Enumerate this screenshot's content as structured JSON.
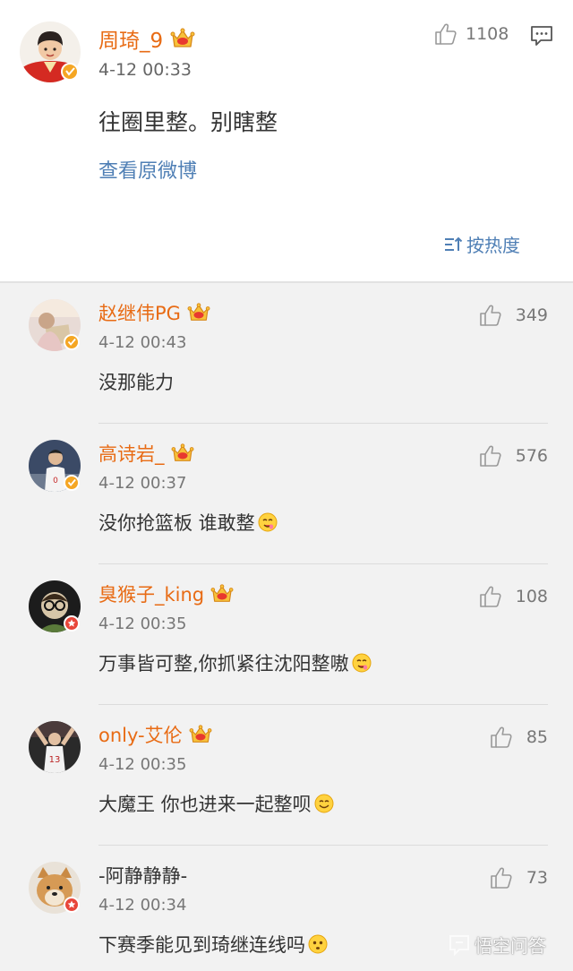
{
  "main_post": {
    "author": "周琦_9",
    "time": "4-12 00:33",
    "content": "往圈里整。别瞎整",
    "view_original": "查看原微博",
    "likes": "1108",
    "sort_label": "按热度"
  },
  "comments": [
    {
      "author": "赵继伟PG",
      "time": "4-12 00:43",
      "text": "没那能力",
      "likes": "349"
    },
    {
      "author": "高诗岩_",
      "time": "4-12 00:37",
      "text": "没你抢篮板 谁敢整",
      "likes": "576"
    },
    {
      "author": "臭猴子_king",
      "time": "4-12 00:35",
      "text": "万事皆可整,你抓紧往沈阳整嗷",
      "likes": "108"
    },
    {
      "author": "only-艾伦",
      "time": "4-12 00:35",
      "text": "大魔王 你也进来一起整呗",
      "likes": "85"
    },
    {
      "author": "-阿静静静-",
      "time": "4-12 00:34",
      "text": "下赛季能见到琦继连线吗",
      "likes": "73"
    }
  ],
  "watermark": "悟空问答",
  "colors": {
    "username": "#e86b14",
    "link": "#4f7fb5",
    "verified_badge": "#f5a623",
    "background": "#f2f2f2"
  },
  "icons": {
    "like": "thumb-up-icon",
    "comment": "comment-icon",
    "sort": "sort-icon",
    "vip": "crown-icon",
    "verified": "verified-badge-icon"
  }
}
